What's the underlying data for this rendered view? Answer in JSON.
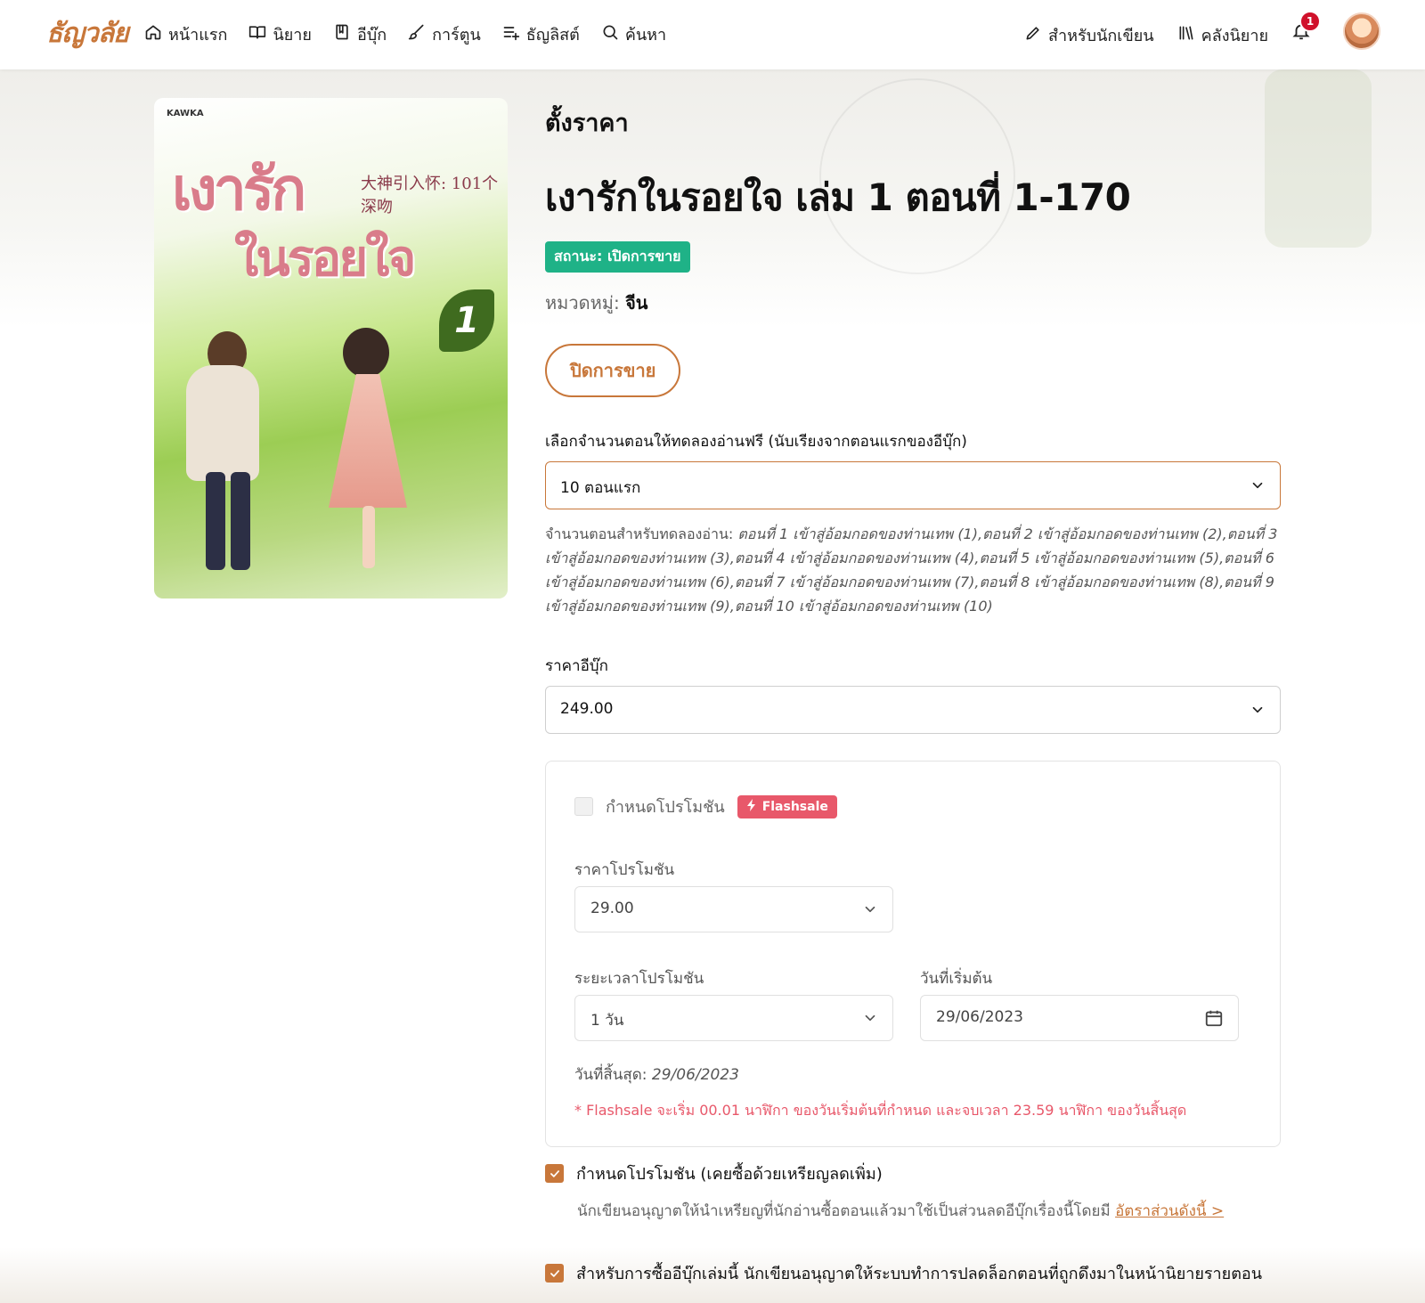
{
  "brand": {
    "logo_text": "ธัญวลัย",
    "accent": "#c8773a",
    "status_green": "#1fb287",
    "flash_red": "#e8586a"
  },
  "nav": {
    "left": [
      {
        "label": "หน้าแรก",
        "icon": "home-icon"
      },
      {
        "label": "นิยาย",
        "icon": "book-open-icon"
      },
      {
        "label": "อีบุ๊ก",
        "icon": "ebook-icon"
      },
      {
        "label": "การ์ตูน",
        "icon": "brush-icon"
      },
      {
        "label": "ธัญลิสต์",
        "icon": "list-add-icon"
      },
      {
        "label": "ค้นหา",
        "icon": "search-icon"
      }
    ],
    "right": [
      {
        "label": "สำหรับนักเขียน",
        "icon": "pencil-icon"
      },
      {
        "label": "คลังนิยาย",
        "icon": "library-icon"
      }
    ],
    "notification_count": "1"
  },
  "page": {
    "section_title": "ตั้งราคา",
    "book_title": "เงารักในรอยใจ เล่ม 1 ตอนที่ 1-170",
    "status": "สถานะ: เปิดการขาย",
    "category_label": "หมวดหมู่:",
    "category_value": "จีน",
    "close_sale_button": "ปิดการขาย"
  },
  "cover": {
    "publisher": "KAWKA",
    "title_line1": "เงารัก",
    "title_line2": "ในรอยใจ",
    "chinese_title": "大神引入怀: 101个深吻",
    "volume": "1"
  },
  "free_trial": {
    "label": "เลือกจำนวนตอนให้ทดลองอ่านฟรี (นับเรียงจากตอนแรกของอีบุ๊ก)",
    "selected": "10 ตอนแรก",
    "summary_label": "จำนวนตอนสำหรับทดลองอ่าน:",
    "summary_value": "ตอนที่ 1 เข้าสู่อ้อมกอดของท่านเทพ (1),ตอนที่ 2 เข้าสู่อ้อมกอดของท่านเทพ (2),ตอนที่ 3 เข้าสู่อ้อมกอดของท่านเทพ (3),ตอนที่ 4 เข้าสู่อ้อมกอดของท่านเทพ (4),ตอนที่ 5 เข้าสู่อ้อมกอดของท่านเทพ (5),ตอนที่ 6 เข้าสู่อ้อมกอดของท่านเทพ (6),ตอนที่ 7 เข้าสู่อ้อมกอดของท่านเทพ (7),ตอนที่ 8 เข้าสู่อ้อมกอดของท่านเทพ (8),ตอนที่ 9 เข้าสู่อ้อมกอดของท่านเทพ (9),ตอนที่ 10 เข้าสู่อ้อมกอดของท่านเทพ (10)"
  },
  "price": {
    "label": "ราคาอีบุ๊ก",
    "value": "249.00"
  },
  "promo": {
    "checkbox_label": "กำหนดโปรโมชัน",
    "checked": false,
    "flash_badge": "Flashsale",
    "price_label": "ราคาโปรโมชัน",
    "price_value": "29.00",
    "duration_label": "ระยะเวลาโปรโมชัน",
    "duration_value": "1 วัน",
    "start_label": "วันที่เริ่มต้น",
    "start_value": "29/06/2023",
    "end_label": "วันที่สิ้นสุด:",
    "end_value": "29/06/2023",
    "note": "* Flashsale จะเริ่ม 00.01 นาฬิกา ของวันเริ่มต้นที่กำหนด และจบเวลา 23.59 นาฬิกา ของวันสิ้นสุด"
  },
  "coin_promo": {
    "label": "กำหนดโปรโมชัน (เคยซื้อด้วยเหรียญลดเพิ่ม)",
    "checked": true,
    "description": "นักเขียนอนุญาตให้นำเหรียญที่นักอ่านซื้อตอนแล้วมาใช้เป็นส่วนลดอีบุ๊กเรื่องนี้โดยมี",
    "link": "อัตราส่วนดังนี้ >"
  },
  "unlock": {
    "label": "สำหรับการซื้ออีบุ๊กเล่มนี้ นักเขียนอนุญาตให้ระบบทำการปลดล็อกตอนที่ถูกดึงมาในหน้านิยายรายตอน",
    "checked": true
  }
}
